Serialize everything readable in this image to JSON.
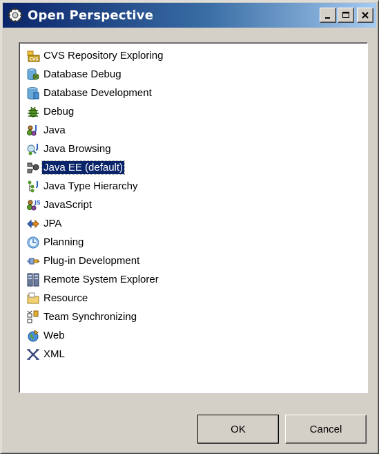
{
  "window": {
    "title": "Open Perspective",
    "icon": "perspective-icon"
  },
  "titlebar_buttons": {
    "minimize": "minimize-icon",
    "maximize": "maximize-icon",
    "close": "close-icon"
  },
  "perspectives": [
    {
      "label": "CVS Repository Exploring",
      "icon": "cvs-repository-icon"
    },
    {
      "label": "Database Debug",
      "icon": "database-debug-icon"
    },
    {
      "label": "Database Development",
      "icon": "database-icon"
    },
    {
      "label": "Debug",
      "icon": "debug-bug-icon"
    },
    {
      "label": "Java",
      "icon": "java-icon"
    },
    {
      "label": "Java Browsing",
      "icon": "java-browsing-icon"
    },
    {
      "label": "Java EE (default)",
      "icon": "java-ee-icon",
      "selected": true
    },
    {
      "label": "Java Type Hierarchy",
      "icon": "type-hierarchy-icon"
    },
    {
      "label": "JavaScript",
      "icon": "javascript-icon"
    },
    {
      "label": "JPA",
      "icon": "jpa-icon"
    },
    {
      "label": "Planning",
      "icon": "planning-clock-icon"
    },
    {
      "label": "Plug-in Development",
      "icon": "plugin-icon"
    },
    {
      "label": "Remote System Explorer",
      "icon": "remote-system-icon"
    },
    {
      "label": "Resource",
      "icon": "folder-icon"
    },
    {
      "label": "Team Synchronizing",
      "icon": "team-sync-icon"
    },
    {
      "label": "Web",
      "icon": "web-globe-icon"
    },
    {
      "label": "XML",
      "icon": "xml-icon"
    }
  ],
  "buttons": {
    "ok": "OK",
    "cancel": "Cancel"
  },
  "colors": {
    "selection": "#0a246a",
    "title_gradient_start": "#0a246a",
    "title_gradient_end": "#a6caf0",
    "dialog_bg": "#d4d0c8"
  }
}
